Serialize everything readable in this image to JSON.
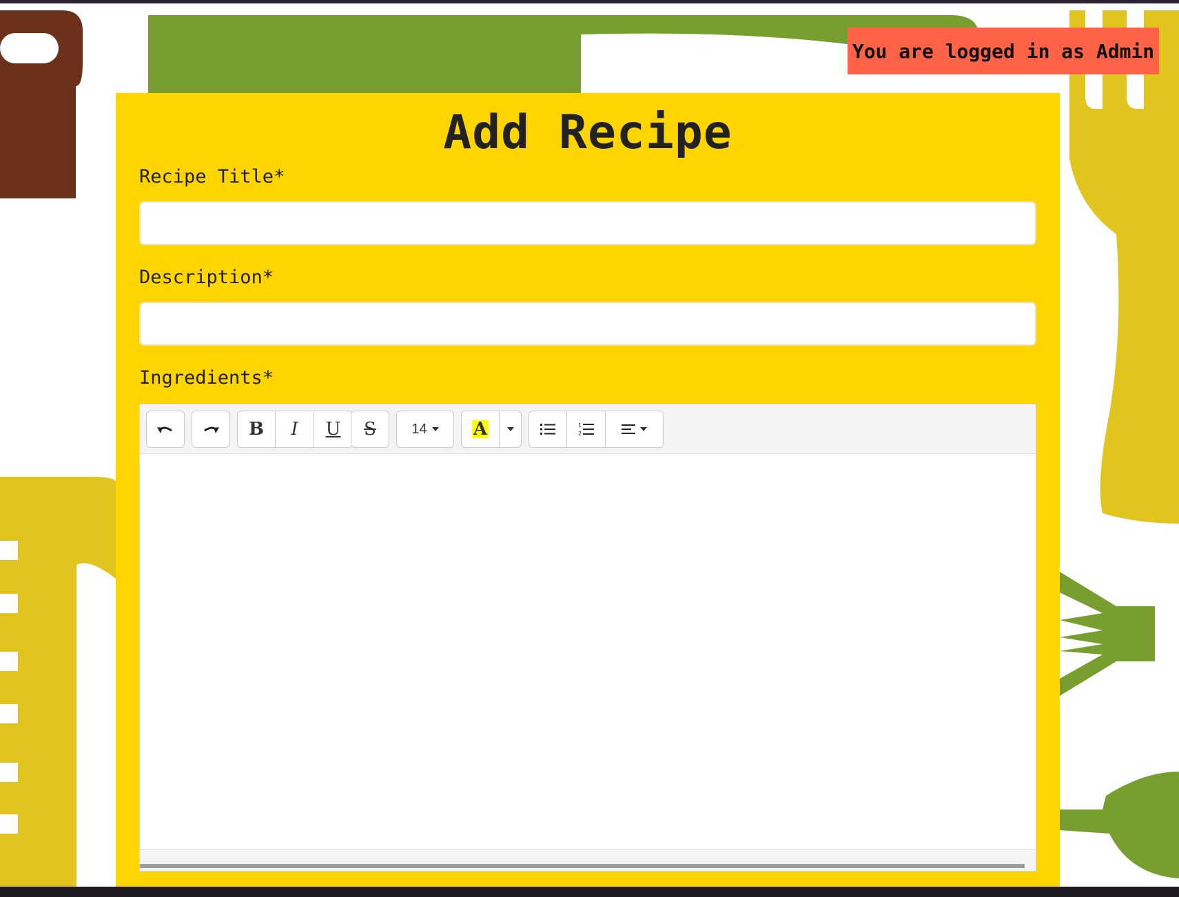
{
  "session": {
    "login_text": "You are logged in as Admin"
  },
  "form": {
    "title": "Add Recipe",
    "recipe_title_label": "Recipe Title*",
    "recipe_title_value": "",
    "description_label": "Description*",
    "description_value": "",
    "ingredients_label": "Ingredients*"
  },
  "toolbar": {
    "undo_icon": "undo-icon",
    "redo_icon": "redo-icon",
    "bold": "B",
    "italic": "I",
    "underline": "U",
    "strikethrough": "S",
    "font_size": "14",
    "highlight_letter": "A",
    "unordered_list_icon": "unordered-list-icon",
    "ordered_list_icon": "ordered-list-icon",
    "align_icon": "align-icon"
  },
  "colors": {
    "panel_bg": "#FFD500",
    "badge_bg": "#FF6347",
    "green": "#789E30",
    "mustard": "#E1C41D",
    "brown": "#6B311A",
    "highlight": "#FFFF00"
  }
}
